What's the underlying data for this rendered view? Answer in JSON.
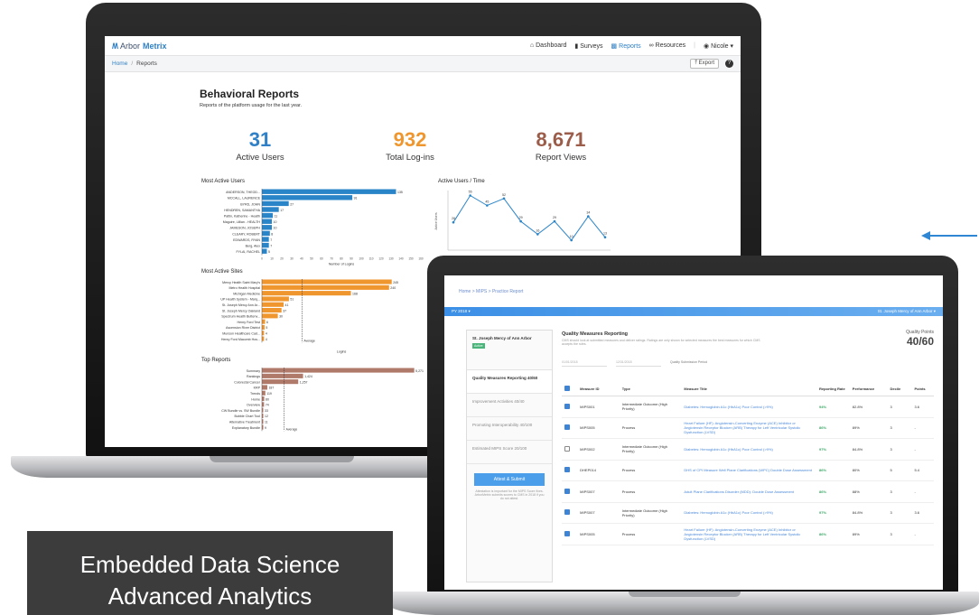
{
  "big_app": {
    "logo_prefix": "Arbor",
    "logo_suffix": "Metrix",
    "nav": [
      {
        "label": "Dashboard",
        "icon": "home-icon"
      },
      {
        "label": "Surveys",
        "icon": "clipboard-icon"
      },
      {
        "label": "Reports",
        "icon": "bar-chart-icon"
      },
      {
        "label": "Resources",
        "icon": "link-icon"
      }
    ],
    "user": "Nicole",
    "breadcrumb_home": "Home",
    "breadcrumb_current": "Reports",
    "export_label": "Export",
    "help": "?",
    "page_title": "Behavioral Reports",
    "page_subtitle": "Reports of the platform usage for the last year.",
    "kpis": [
      {
        "value": "31",
        "label": "Active Users",
        "color": "#2f80c6"
      },
      {
        "value": "932",
        "label": "Total Log-ins",
        "color": "#f0962e"
      },
      {
        "value": "8,671",
        "label": "Report Views",
        "color": "#9b5d4a"
      }
    ],
    "colors": {
      "blue": "#2a84c8",
      "orange": "#f0962e",
      "brown": "#b07a6a"
    }
  },
  "chart_data": [
    {
      "type": "bar",
      "title": "Most Active Users",
      "xlabel": "Number of Logins",
      "categories": [
        "ANDERSON, THEOD...",
        "MCCALL, LAURENCE",
        "BYRD, JOHN",
        "HENDREN, SAMANTHA",
        "Pattin, Katherine - Health",
        "Maguire, Lillian - HEALTH",
        "JAMESON, JOSEPH",
        "CLEARY, ROBERT",
        "EDWARDS, RYAN",
        "Berg, Alex",
        "FYLAI, RACHEL"
      ],
      "values": [
        135,
        91,
        27,
        17,
        11,
        10,
        10,
        8,
        7,
        7,
        5
      ],
      "xlim": [
        0,
        160
      ],
      "xticks": [
        "0",
        "10",
        "20",
        "30",
        "40",
        "50",
        "60",
        "70",
        "80",
        "90",
        "100",
        "110",
        "120",
        "130",
        "140",
        "150",
        "160"
      ]
    },
    {
      "type": "line",
      "title": "Active Users / Time",
      "ylabel": "Active Users",
      "values": [
        28,
        55,
        45,
        52,
        29,
        16,
        29,
        10,
        34,
        13
      ],
      "ylim": [
        0,
        60
      ]
    },
    {
      "type": "bar",
      "title": "Most Active Sites",
      "xlabel": "Logins",
      "categories": [
        "Mercy Health Saint Mary's",
        "Metro Health Hospital",
        "Michigan Medicine",
        "UP Health System - Marq...",
        "St. Joseph Mercy Ann Ar...",
        "St. Joseph Mercy Oakland",
        "Spectrum Health Butterw...",
        "Henry Ford Test",
        "Ascension River District",
        "Munson Healthcare Cad...",
        "Henry Ford Macomb Hos..."
      ],
      "values": [
        245,
        240,
        168,
        51,
        41,
        37,
        30,
        6,
        5,
        4,
        4
      ],
      "xlim": [
        0,
        300
      ],
      "average_label": "Average"
    },
    {
      "type": "bar",
      "title": "Top Reports",
      "categories": [
        "Summary",
        "Rankings",
        "Colorectal Cancer",
        "KRP",
        "Trends",
        "Home",
        "Overview",
        "CW Bundle vs. SW Bundle",
        "Bubble Chart Tool",
        "Alternative Treatment",
        "Explanatory Bundle"
      ],
      "values": [
        5271,
        1424,
        1257,
        187,
        119,
        80,
        74,
        33,
        12,
        11,
        9
      ],
      "xlim": [
        0,
        5500
      ],
      "average_label": "Average"
    }
  ],
  "small_app": {
    "breadcrumb": "Home > MIPS > Practice Report",
    "band_left": "PY 2018",
    "band_right": "St. Joseph Mercy of Ann Arbor",
    "org_name": "St. Joseph Mercy of Ann Arbor",
    "org_tag": "Active",
    "side_items": [
      {
        "label": "Quality Measures Reporting 40/60",
        "active": true
      },
      {
        "label": "Improvement Activities 40/40",
        "active": false
      },
      {
        "label": "Promoting Interoperability 40/100",
        "active": false
      },
      {
        "label": "Estimated MIPS Score 20/100",
        "active": false
      }
    ],
    "side_button": "Attest & Submit",
    "side_note": "Attestation is important for the MIPS Score fixes. ArborMetrix submits scores to CMS in 2018 if you do not attest.",
    "main_title": "Quality Measures Reporting",
    "main_desc": "CMS should look at submitted measures and deliver ratings. Ratings are only shown for selected measures the best measures for which CMS accepts the rules.",
    "date_from": "01/01/2018",
    "date_to": "12/31/2018",
    "date_label": "Quality Submission Period",
    "qp_label": "Quality Points",
    "qp_value": "40/60",
    "table_headers": [
      "",
      "Measure ID",
      "Type",
      "Measure Title",
      "Reporting Rate",
      "Performance",
      "Decile",
      "Points"
    ],
    "rows": [
      {
        "checked": true,
        "id": "MIPS001",
        "type": "Intermediate Outcome (High Priority)",
        "title": "Diabetes: Hemoglobin A1c (HbA1c) Poor Control (>9%)",
        "rate": "94%",
        "perf": "82.8%",
        "decile": "3",
        "points": "3.6"
      },
      {
        "checked": true,
        "id": "MIPS005",
        "type": "Process",
        "title": "Heart Failure (HF): Angiotensin-Converting Enzyme (ACE) Inhibitor or Angiotensin Receptor Blocker (ARB) Therapy for Left Ventricular Systolic Dysfunction (LVSD)",
        "rate": "86%",
        "perf": "89%",
        "decile": "3",
        "points": "-"
      },
      {
        "checked": false,
        "id": "MIPS002",
        "type": "Intermediate Outcome (High Priority)",
        "title": "Diabetes: Hemoglobin A1c (HbA1c) Poor Control (>9%)",
        "rate": "97%",
        "perf": "84.8%",
        "decile": "3",
        "points": "-"
      },
      {
        "checked": true,
        "id": "DHEP014",
        "type": "Process",
        "title": "DHS of CPI Measure Well Plane Clarifications (WPC) Double Dose Assessment",
        "rate": "86%",
        "perf": "80%",
        "decile": "5",
        "points": "5.4"
      },
      {
        "checked": true,
        "id": "MIPS007",
        "type": "Process",
        "title": "Adult Plane Clarifications Disorder (MDD): Double Dose Assessment",
        "rate": "86%",
        "perf": "88%",
        "decile": "3",
        "points": "-"
      },
      {
        "checked": true,
        "id": "MIPS007",
        "type": "Intermediate Outcome (High Priority)",
        "title": "Diabetes: Hemoglobin A1c (HbA1c) Poor Control (>9%)",
        "rate": "97%",
        "perf": "84.8%",
        "decile": "3",
        "points": "3.6"
      },
      {
        "checked": true,
        "id": "MIPS005",
        "type": "Process",
        "title": "Heart Failure (HF): Angiotensin-Converting Enzyme (ACE) Inhibitor or Angiotensin Receptor Blocker (ARB) Therapy for Left Ventricular Systolic Dysfunction (LVSD)",
        "rate": "86%",
        "perf": "89%",
        "decile": "3",
        "points": "-"
      }
    ]
  },
  "caption": {
    "line1": "Embedded Data Science",
    "line2": "Advanced Analytics"
  }
}
